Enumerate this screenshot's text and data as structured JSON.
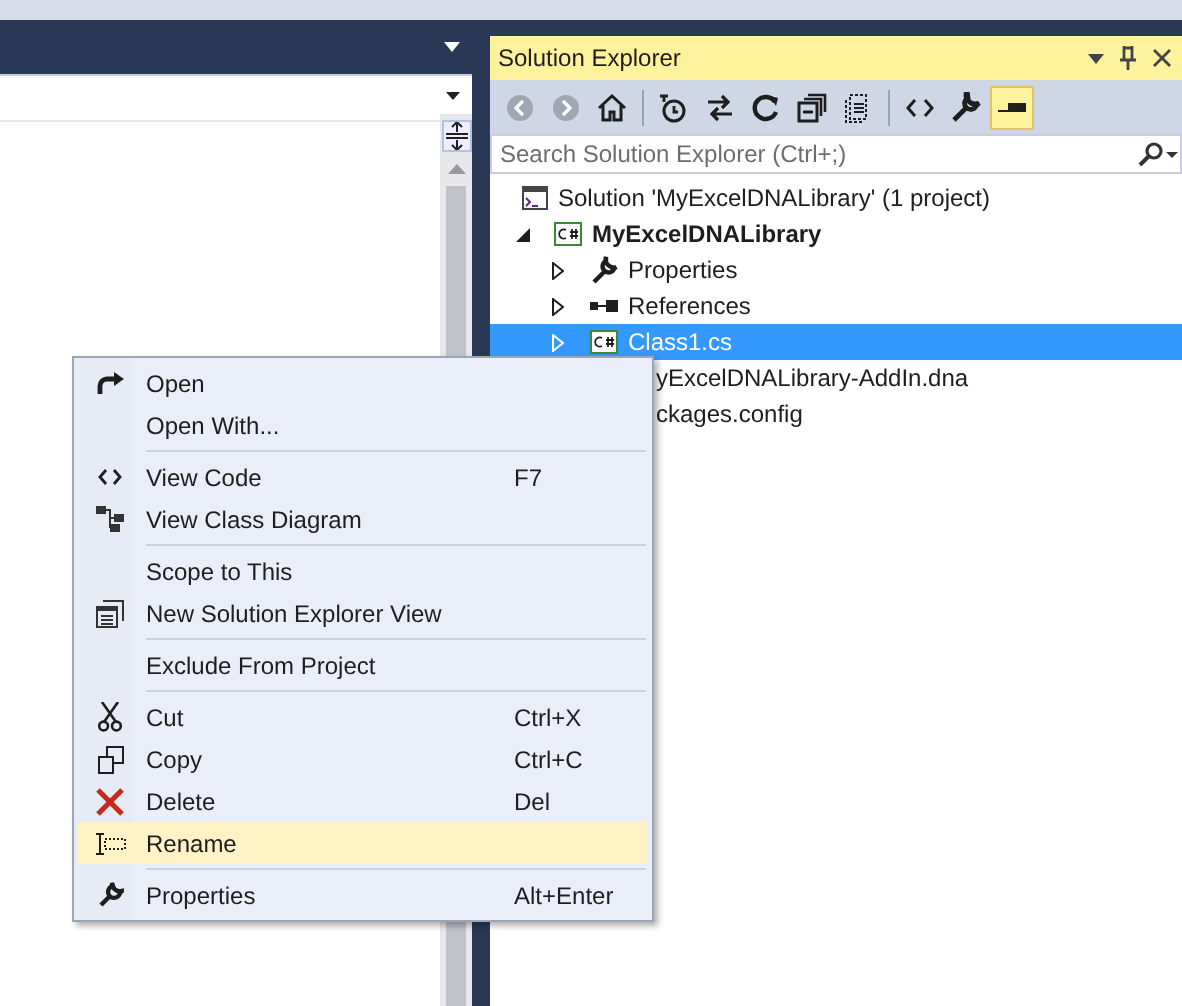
{
  "solution_explorer": {
    "title": "Solution Explorer",
    "toolbar": [
      {
        "disabled": true,
        "selected": false
      },
      {
        "disabled": true,
        "selected": false
      },
      {
        "disabled": false,
        "selected": false
      },
      {
        "disabled": false,
        "selected": false
      },
      {
        "disabled": false,
        "selected": false
      },
      {
        "disabled": false,
        "selected": false
      },
      {
        "disabled": false,
        "selected": false
      },
      {
        "disabled": false,
        "selected": false
      },
      {
        "disabled": false,
        "selected": false
      },
      {
        "disabled": false,
        "selected": false
      },
      {
        "disabled": false,
        "selected": true
      }
    ],
    "search": {
      "placeholder": "Search Solution Explorer (Ctrl+;)"
    },
    "tree": [
      {
        "kind": "solution",
        "label": "Solution 'MyExcelDNALibrary' (1 project)",
        "selected": false,
        "children": [
          {
            "kind": "project",
            "label": "MyExcelDNALibrary",
            "expanded": true,
            "selected": false,
            "children": [
              {
                "kind": "properties",
                "label": "Properties",
                "expanded": false,
                "selected": false
              },
              {
                "kind": "references",
                "label": "References",
                "expanded": false,
                "selected": false
              },
              {
                "kind": "csfile",
                "label": "Class1.cs",
                "expanded": false,
                "selected": true
              },
              {
                "kind": "covered",
                "label": "yExcelDNALibrary-AddIn.dna",
                "selected": false
              },
              {
                "kind": "covered",
                "label": "ckages.config",
                "selected": false
              }
            ]
          }
        ]
      }
    ]
  },
  "context_menu": [
    {
      "kind": "item",
      "label": "Open",
      "selected": false
    },
    {
      "kind": "item",
      "label": "Open With...",
      "selected": false
    },
    {
      "kind": "separator"
    },
    {
      "kind": "item",
      "label": "View Code",
      "shortcut": "F7",
      "selected": false
    },
    {
      "kind": "item",
      "label": "View Class Diagram",
      "selected": false
    },
    {
      "kind": "separator"
    },
    {
      "kind": "item",
      "label": "Scope to This",
      "selected": false
    },
    {
      "kind": "item",
      "label": "New Solution Explorer View",
      "selected": false
    },
    {
      "kind": "separator"
    },
    {
      "kind": "item",
      "label": "Exclude From Project",
      "selected": false
    },
    {
      "kind": "separator"
    },
    {
      "kind": "item",
      "label": "Cut",
      "shortcut": "Ctrl+X",
      "selected": false
    },
    {
      "kind": "item",
      "label": "Copy",
      "shortcut": "Ctrl+C",
      "selected": false
    },
    {
      "kind": "item",
      "label": "Delete",
      "shortcut": "Del",
      "selected": false
    },
    {
      "kind": "item",
      "label": "Rename",
      "selected": true
    },
    {
      "kind": "separator"
    },
    {
      "kind": "item",
      "label": "Properties",
      "shortcut": "Alt+Enter",
      "selected": false
    }
  ]
}
